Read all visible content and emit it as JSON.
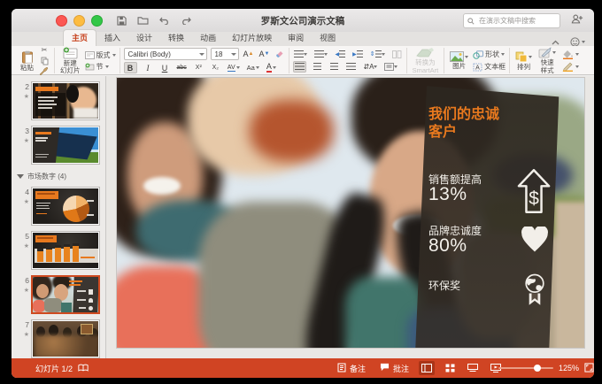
{
  "titlebar": {
    "title": "罗斯文公司演示文稿",
    "search_placeholder": "在演示文稿中搜索"
  },
  "tabs": [
    {
      "label": "主页"
    },
    {
      "label": "插入"
    },
    {
      "label": "设计"
    },
    {
      "label": "转换"
    },
    {
      "label": "动画"
    },
    {
      "label": "幻灯片放映"
    },
    {
      "label": "审阅"
    },
    {
      "label": "视图"
    }
  ],
  "ribbon": {
    "paste_label": "粘贴",
    "new_slide_line1": "新建",
    "new_slide_line2": "幻灯片",
    "layout_label": "版式",
    "section_label": "节",
    "font_name": "Calibri (Body)",
    "font_size": "18",
    "bold": "B",
    "italic": "I",
    "underline": "U",
    "strike": "abc",
    "superscript": "X²",
    "subscript": "X₂",
    "spacing": "AV",
    "case": "Aa",
    "font_color": "A",
    "grow_font": "A▴",
    "shrink_font": "A▾",
    "smartart_line1": "转换为",
    "smartart_line2": "SmartArt",
    "picture_label": "图片",
    "shapes_label": "形状",
    "textbox_label": "文本框",
    "arrange_label": "排列",
    "quick_styles_line1": "快速",
    "quick_styles_line2": "样式"
  },
  "sidebar": {
    "section_label": "市场数字 (4)",
    "star": "★",
    "slides": [
      {
        "num": "2"
      },
      {
        "num": "3"
      },
      {
        "num": "4"
      },
      {
        "num": "5"
      },
      {
        "num": "6"
      },
      {
        "num": "7"
      }
    ]
  },
  "slide": {
    "title_line1": "我们的忠诚",
    "title_line2": "客户",
    "stat1_label": "销售额提高",
    "stat1_value": "13%",
    "stat2_label": "品牌忠诚度",
    "stat2_value": "80%",
    "stat3_label": "环保奖",
    "dollar_sign": "$"
  },
  "statusbar": {
    "slide_indicator": "幻灯片 1/2",
    "notes_label": "备注",
    "comments_label": "批注",
    "zoom_value": "125%"
  },
  "colors": {
    "accent": "#D04423",
    "slide_accent": "#E8791E"
  }
}
